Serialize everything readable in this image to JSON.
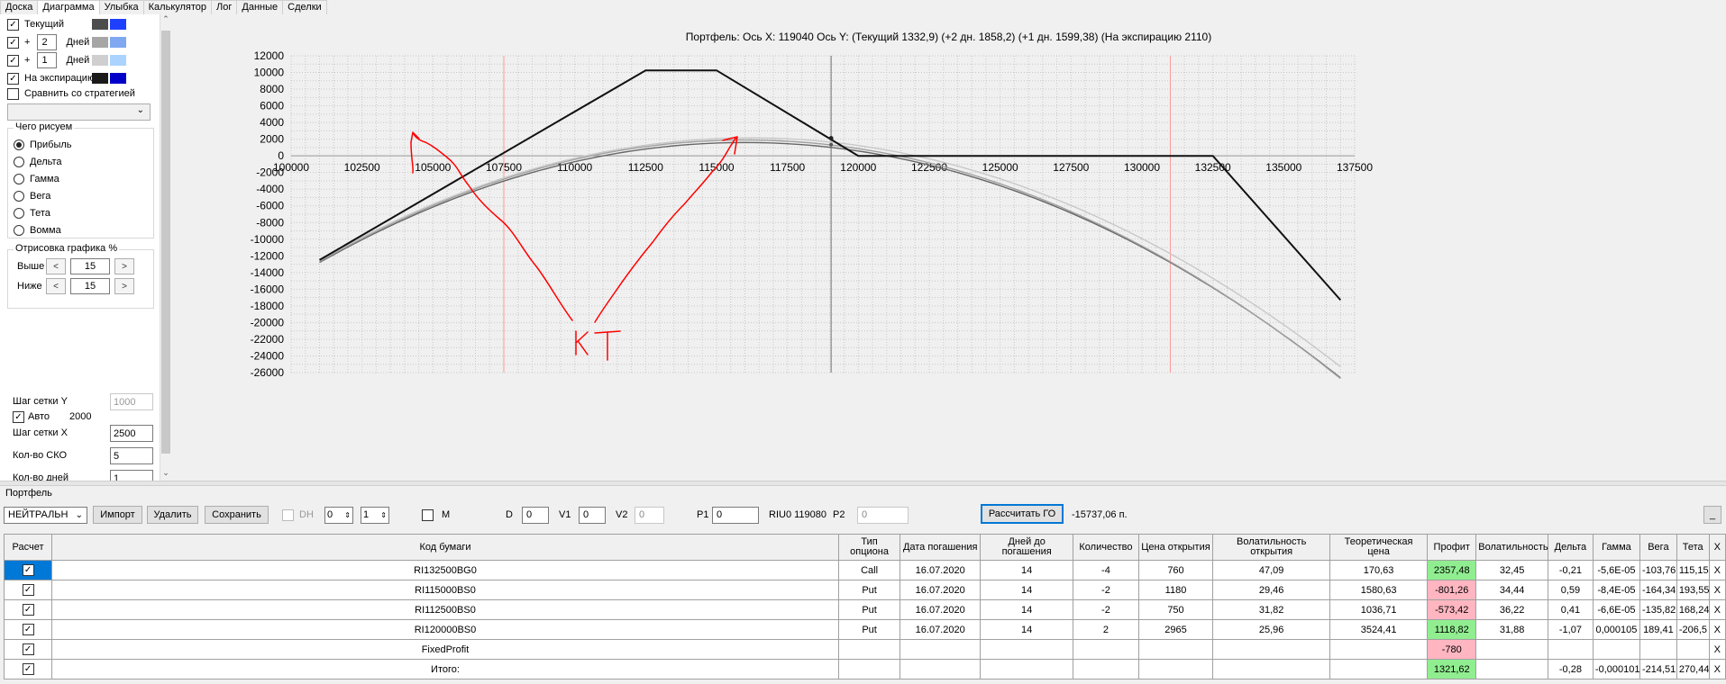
{
  "tabs": [
    "Доска",
    "Диаграмма",
    "Улыбка",
    "Калькулятор",
    "Лог",
    "Данные",
    "Сделки"
  ],
  "active_tab": "Диаграмма",
  "left": {
    "series_rows": [
      {
        "checked": true,
        "plus": "",
        "value": "",
        "label": "Текущий",
        "colors": [
          "#4d4d4d",
          "#1f3fff"
        ]
      },
      {
        "checked": true,
        "plus": "+",
        "value": "2",
        "label": "Дней",
        "colors": [
          "#a6a6a6",
          "#7fa8f0"
        ]
      },
      {
        "checked": true,
        "plus": "+",
        "value": "1",
        "label": "Дней",
        "colors": [
          "#cfcfcf",
          "#aad4ff"
        ]
      },
      {
        "checked": true,
        "plus": "",
        "value": "",
        "label": "На экспирацию",
        "colors": [
          "#1a1a1a",
          "#0000c8"
        ]
      }
    ],
    "compare_label": "Сравнить со стратегией",
    "compare_checked": false,
    "draw_group_title": "Чего рисуем",
    "draw_options": [
      "Прибыль",
      "Дельта",
      "Гамма",
      "Вега",
      "Тета",
      "Вомма"
    ],
    "draw_selected": "Прибыль",
    "range_group_title": "Отрисовка графика %",
    "above_label": "Выше",
    "above_value": "15",
    "below_label": "Ниже",
    "below_value": "15",
    "btn_left": "<",
    "btn_right": ">",
    "grid_y_label": "Шаг сетки Y",
    "grid_y_value": "1000",
    "auto_label": "Авто",
    "auto_checked": true,
    "auto_value": "2000",
    "grid_x_label": "Шаг сетки X",
    "grid_x_value": "2500",
    "sko_label": "Кол-во СКО",
    "sko_value": "5",
    "days_label": "Кол-во дней",
    "days_value": "1"
  },
  "chart_title": "Портфель: Ось X: 119040 Ось Y:  (Текущий 1332,9)  (+2 дн. 1858,2)  (+1 дн. 1599,38)  (На экспирацию 2110)",
  "chart_data": {
    "type": "line",
    "xlim": [
      100000,
      137500
    ],
    "ylim": [
      -26000,
      12000
    ],
    "x_ticks": [
      100000,
      102500,
      105000,
      107500,
      110000,
      112500,
      115000,
      117500,
      120000,
      122500,
      125000,
      127500,
      130000,
      132500,
      135000,
      137500
    ],
    "y_ticks": [
      12000,
      10000,
      8000,
      6000,
      4000,
      2000,
      0,
      -2000,
      -4000,
      -6000,
      -8000,
      -10000,
      -12000,
      -14000,
      -16000,
      -18000,
      -20000,
      -22000,
      -24000,
      -26000
    ],
    "cursor_x": 119040,
    "red_lines_x": [
      107500,
      131000
    ],
    "expiration_series": {
      "x": [
        101000,
        112500,
        115000,
        120000,
        132500,
        137000
      ],
      "y": [
        -12500,
        10250,
        10250,
        0,
        0,
        -17300
      ]
    },
    "curve_series": [
      {
        "vertex_x": 116000,
        "vertex_y": 1600,
        "x_start": 101000,
        "x_end": 137000,
        "y_start": -12800,
        "color": "#666666"
      },
      {
        "vertex_x": 116000,
        "vertex_y": 1900,
        "x_start": 101000,
        "x_end": 137000,
        "y_start": -12700,
        "color": "#a0a0a0"
      },
      {
        "vertex_x": 116200,
        "vertex_y": 2150,
        "x_start": 101000,
        "x_end": 137000,
        "y_start": -12500,
        "color": "#c8c8c8"
      }
    ],
    "annotation": "KT"
  },
  "portfolio": {
    "label": "Портфель",
    "strategy": "НЕЙТРАЛЬН",
    "import_btn": "Импорт",
    "delete_btn": "Удалить",
    "save_btn": "Сохранить",
    "dh_label": "DH",
    "spin1": "0",
    "spin2": "1",
    "m_label": "M",
    "d_label": "D",
    "d_value": "0",
    "v1_label": "V1",
    "v1_value": "0",
    "v2_label": "V2",
    "v2_value": "0",
    "p1_label": "P1",
    "p1_value": "0",
    "riu_label": "RIU0 119080",
    "p2_label": "P2",
    "p2_value": "0",
    "calc_btn": "Рассчитать ГО",
    "go_value": "-15737,06 п.",
    "min_btn": "_"
  },
  "table": {
    "headers": [
      "Расчет",
      "Код бумаги",
      "Тип опциона",
      "Дата погашения",
      "Дней до погашения",
      "Количество",
      "Цена открытия",
      "Волатильность открытия",
      "Теоретическая цена",
      "Профит",
      "Волатильность",
      "Дельта",
      "Гамма",
      "Вега",
      "Тета",
      "X"
    ],
    "rows": [
      [
        "",
        "RI132500BG0",
        "Call",
        "16.07.2020",
        "14",
        "-4",
        "760",
        "47,09",
        "170,63",
        "2357,48",
        "32,45",
        "-0,21",
        "-5,6E-05",
        "-103,76",
        "115,15",
        "X"
      ],
      [
        "",
        "RI115000BS0",
        "Put",
        "16.07.2020",
        "14",
        "-2",
        "1180",
        "29,46",
        "1580,63",
        "-801,26",
        "34,44",
        "0,59",
        "-8,4E-05",
        "-164,34",
        "193,55",
        "X"
      ],
      [
        "",
        "RI112500BS0",
        "Put",
        "16.07.2020",
        "14",
        "-2",
        "750",
        "31,82",
        "1036,71",
        "-573,42",
        "36,22",
        "0,41",
        "-6,6E-05",
        "-135,82",
        "168,24",
        "X"
      ],
      [
        "",
        "RI120000BS0",
        "Put",
        "16.07.2020",
        "14",
        "2",
        "2965",
        "25,96",
        "3524,41",
        "1118,82",
        "31,88",
        "-1,07",
        "0,000105",
        "189,41",
        "-206,5",
        "X"
      ],
      [
        "",
        "FixedProfit",
        "",
        "",
        "",
        "",
        "",
        "",
        "",
        "-780",
        "",
        "",
        "",
        "",
        "",
        "X"
      ],
      [
        "",
        "Итого:",
        "",
        "",
        "",
        "",
        "",
        "",
        "",
        "1321,62",
        "",
        "-0,28",
        "-0,000101",
        "-214,51",
        "270,44",
        "X"
      ]
    ],
    "profit_colors": [
      "pos",
      "neg",
      "neg",
      "pos",
      "neg",
      "pos"
    ]
  }
}
